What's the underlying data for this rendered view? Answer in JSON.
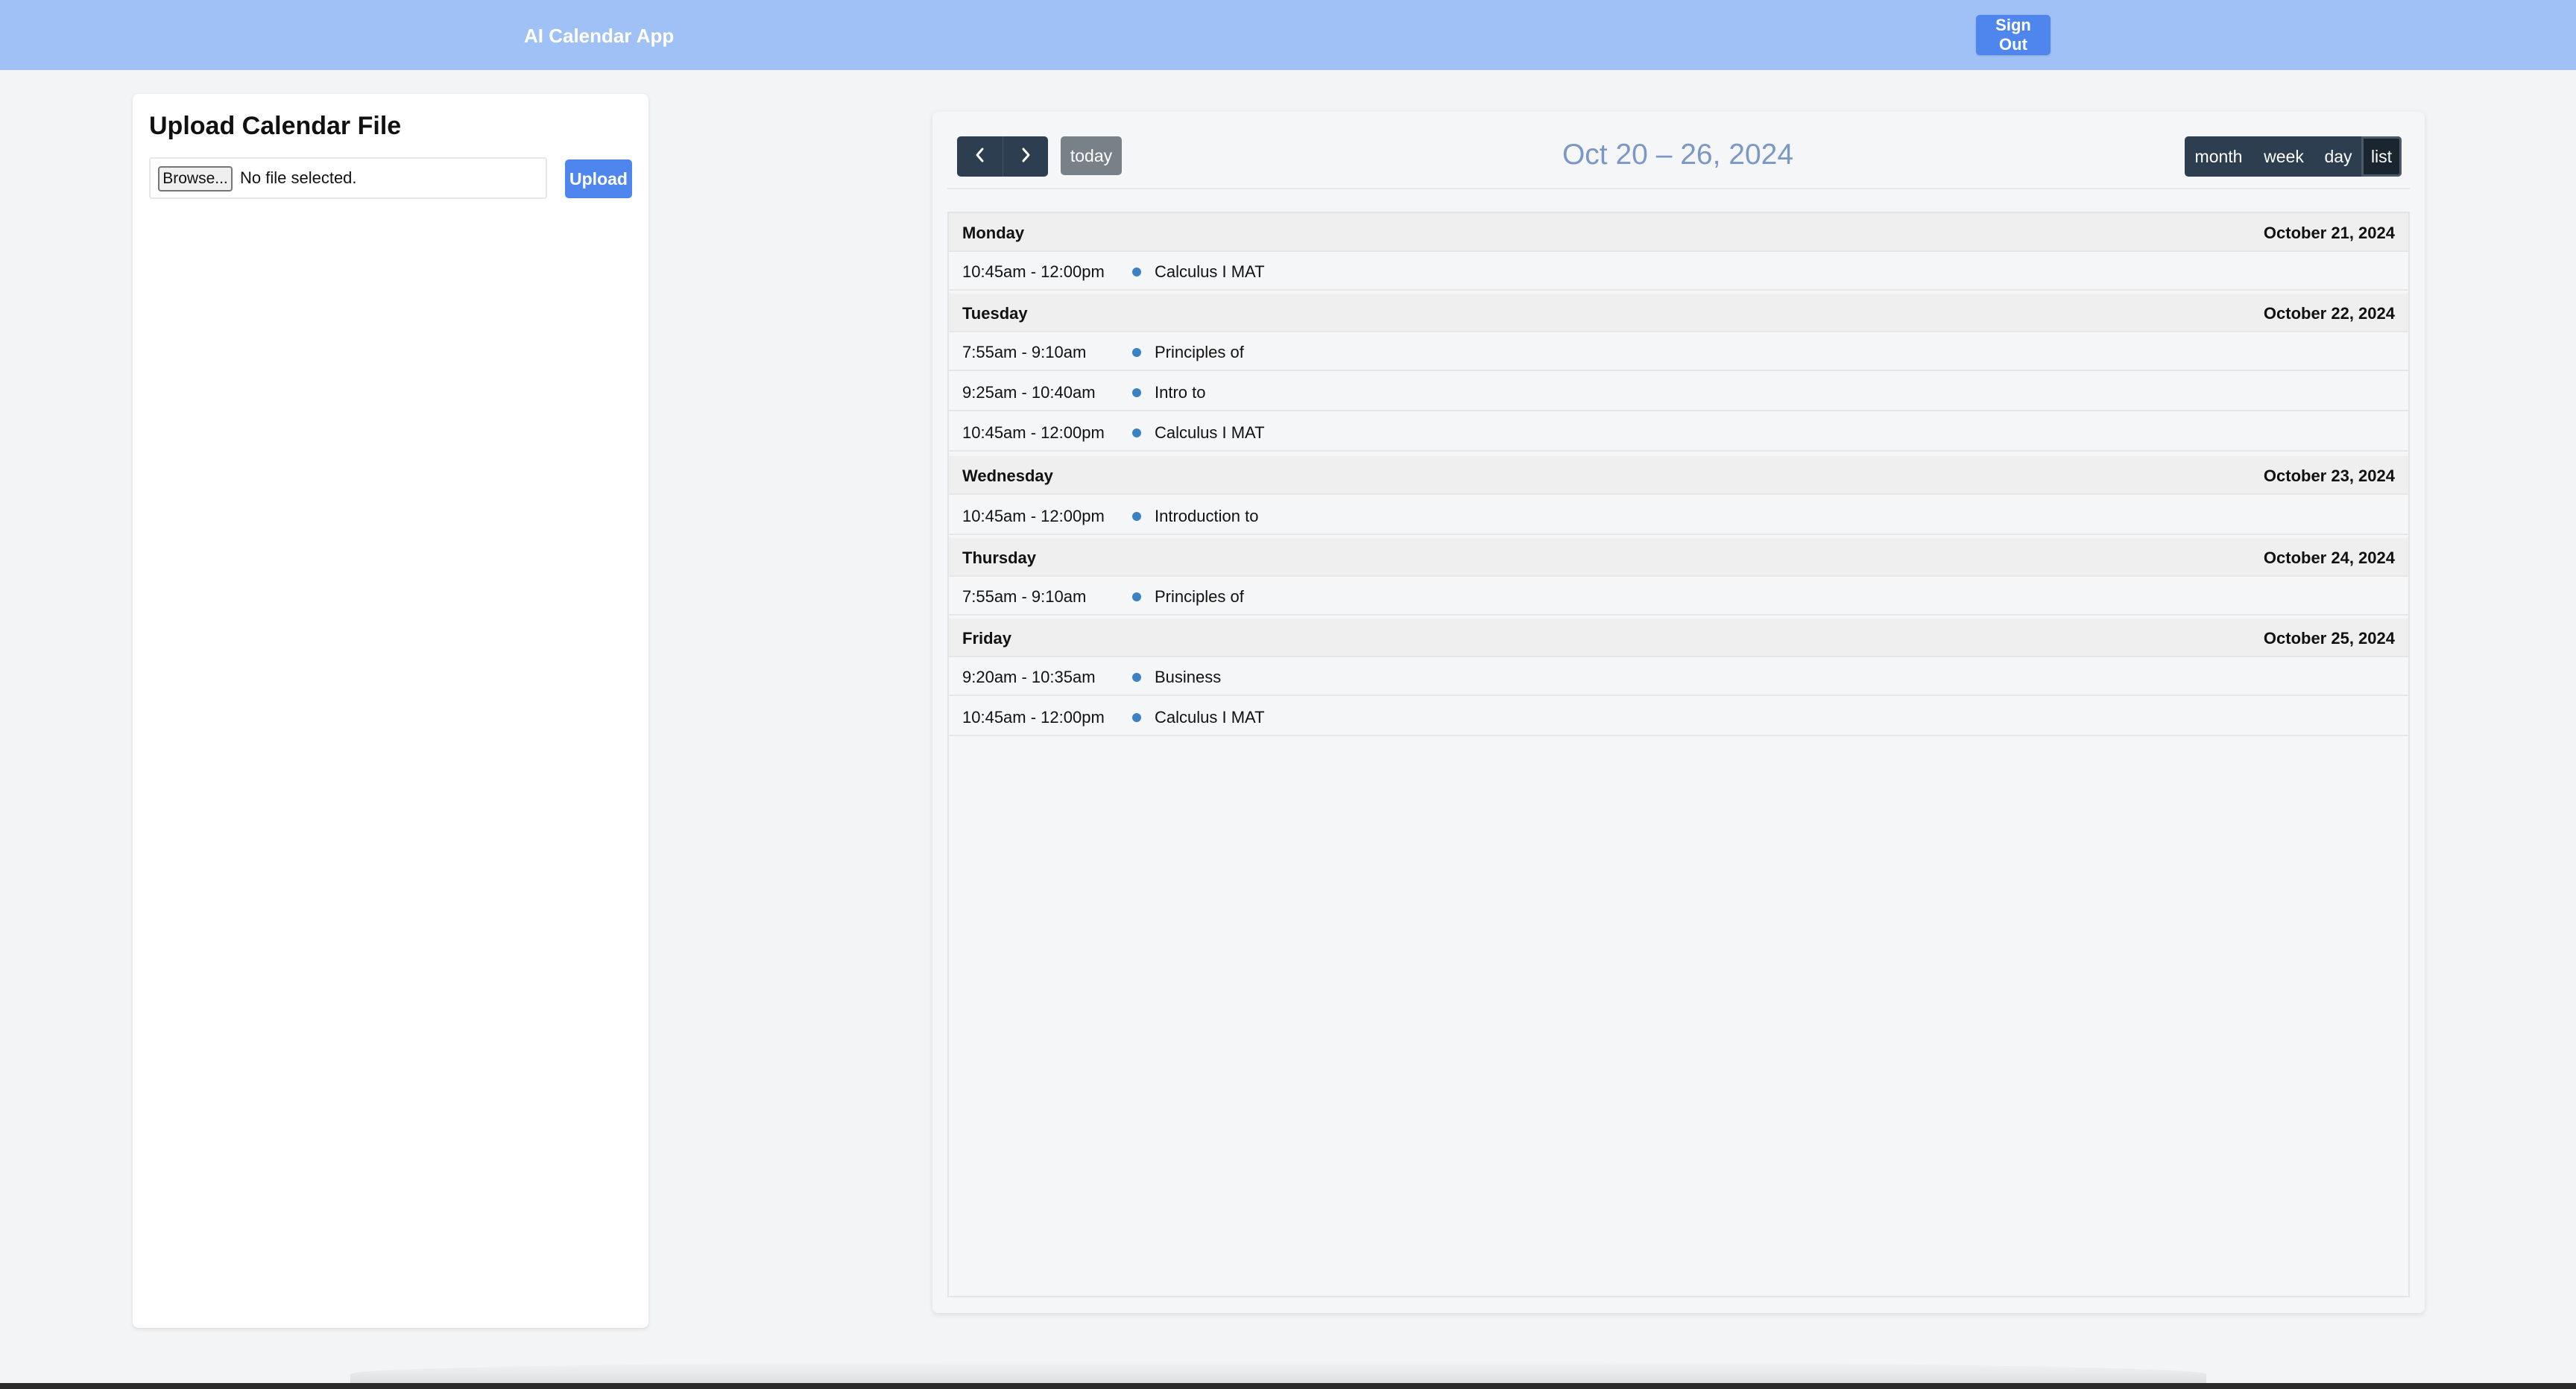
{
  "navbar": {
    "brand": "AI Calendar App",
    "sign_out": "Sign Out",
    "background": "#a0c1f6"
  },
  "upload": {
    "title": "Upload Calendar File",
    "browse_label": "Browse...",
    "file_status": "No file selected.",
    "upload_label": "Upload"
  },
  "calendar": {
    "title": "Oct 20 – 26, 2024",
    "today_label": "today",
    "prev_icon": "chevron-left-icon",
    "next_icon": "chevron-right-icon",
    "views": [
      "month",
      "week",
      "day",
      "list"
    ],
    "active_view": "list",
    "event_color": "#3b82c4",
    "days": [
      {
        "name": "Monday",
        "date": "October 21, 2024",
        "events": [
          {
            "time": "10:45am - 12:00pm",
            "title": "Calculus I MAT"
          }
        ]
      },
      {
        "name": "Tuesday",
        "date": "October 22, 2024",
        "events": [
          {
            "time": "7:55am - 9:10am",
            "title": "Principles of"
          },
          {
            "time": "9:25am - 10:40am",
            "title": "Intro to"
          },
          {
            "time": "10:45am - 12:00pm",
            "title": "Calculus I MAT"
          }
        ]
      },
      {
        "name": "Wednesday",
        "date": "October 23, 2024",
        "events": [
          {
            "time": "10:45am - 12:00pm",
            "title": "Introduction to"
          }
        ]
      },
      {
        "name": "Thursday",
        "date": "October 24, 2024",
        "events": [
          {
            "time": "7:55am - 9:10am",
            "title": "Principles of"
          }
        ]
      },
      {
        "name": "Friday",
        "date": "October 25, 2024",
        "events": [
          {
            "time": "9:20am - 10:35am",
            "title": "Business"
          },
          {
            "time": "10:45am - 12:00pm",
            "title": "Calculus I MAT"
          }
        ]
      }
    ]
  }
}
